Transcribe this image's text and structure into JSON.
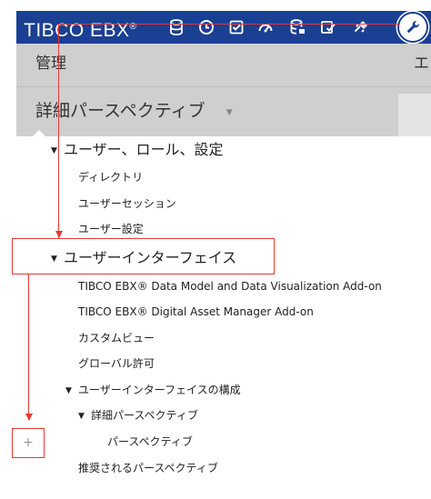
{
  "header": {
    "logo": "TIBCO EBX",
    "logo_sup": "®",
    "icons": [
      {
        "name": "database-icon"
      },
      {
        "name": "clock-icon"
      },
      {
        "name": "checklist-icon"
      },
      {
        "name": "gauge-icon"
      },
      {
        "name": "data-admin-icon"
      },
      {
        "name": "workflow-check-icon"
      },
      {
        "name": "plug-icon"
      }
    ],
    "active_tool": {
      "name": "wrench-icon"
    },
    "accent": "#1a3f93"
  },
  "admin": {
    "title": "管理",
    "right_char": "エ",
    "perspective_title": "詳細パースペクティブ",
    "perspective_caret": "▼"
  },
  "tree": {
    "caret": "▼",
    "users_roles_settings": "ユーザー、ロール、設定",
    "directory": "ディレクトリ",
    "user_sessions": "ユーザーセッション",
    "user_settings": "ユーザー設定",
    "user_interface": "ユーザーインターフェイス",
    "addon_data_model": "TIBCO EBX® Data Model and Data Visualization Add-on",
    "addon_dam": "TIBCO EBX® Digital Asset Manager Add-on",
    "custom_view": "カスタムビュー",
    "global_permissions": "グローバル許可",
    "ui_config": "ユーザーインターフェイスの構成",
    "advanced_perspective": "詳細パースペクティブ",
    "perspective": "パースペクティブ",
    "recommended_perspective": "推奨されるパースペクティブ"
  },
  "annotation": {
    "plus": "+",
    "color": "#e53935"
  }
}
